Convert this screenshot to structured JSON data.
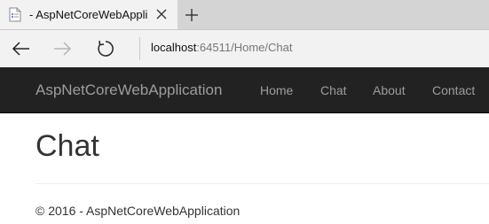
{
  "browser": {
    "tab_title": "- AspNetCoreWebAppli",
    "address_host": "localhost",
    "address_rest": ":64511/Home/Chat"
  },
  "site": {
    "brand": "AspNetCoreWebApplication",
    "nav": [
      "Home",
      "Chat",
      "About",
      "Contact"
    ]
  },
  "page": {
    "title": "Chat",
    "footer": "© 2016 - AspNetCoreWebApplication"
  },
  "icons": {
    "favicon": "page-icon",
    "tab_close": "close-icon",
    "new_tab": "plus-icon",
    "back": "arrow-left-icon",
    "forward": "arrow-right-icon",
    "refresh": "refresh-icon"
  },
  "colors": {
    "navbar_bg": "#222222",
    "nav_text": "#9d9d9d",
    "tabstrip_bg": "#d4d4d4",
    "chrome_bg": "#f2f2f2",
    "body_text": "#333333"
  }
}
